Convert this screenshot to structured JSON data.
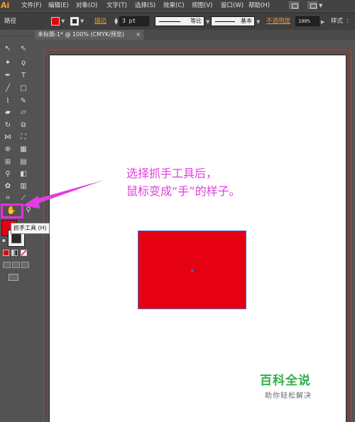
{
  "menubar": {
    "logo": "Ai",
    "items": [
      {
        "label": "文件(F)"
      },
      {
        "label": "编辑(E)"
      },
      {
        "label": "对象(O)"
      },
      {
        "label": "文字(T)"
      },
      {
        "label": "选择(S)"
      },
      {
        "label": "效果(C)"
      },
      {
        "label": "视图(V)"
      },
      {
        "label": "窗口(W)"
      },
      {
        "label": "帮助(H)"
      }
    ]
  },
  "controlbar": {
    "object_type": "路径",
    "fill_color": "#e50012",
    "stroke_label": "描边",
    "stroke_weight": "3 pt",
    "profile_label": "等比",
    "brush_label": "基本",
    "opacity_label": "不透明度",
    "opacity_value": "100%",
    "style_label": "样式"
  },
  "document": {
    "tab_title": "未标题-1* @ 100% (CMYK/预览)",
    "tab_close": "×"
  },
  "tooltip": {
    "text": "抓手工具 (H)"
  },
  "annotation": {
    "line1": "选择抓手工具后，",
    "line2": "鼠标变成“手”的样子。"
  },
  "shape": {
    "fill": "#e50012",
    "stroke": "#4a6ed0"
  },
  "watermark": {
    "title": "百科全说",
    "subtitle": "助你轻松解决"
  },
  "icons": {
    "selection": "selection-arrow-icon",
    "direct_selection": "direct-selection-arrow-icon",
    "magic_wand": "magic-wand-icon",
    "lasso": "lasso-icon",
    "pen": "pen-icon",
    "type": "type-icon",
    "line": "line-segment-icon",
    "rectangle": "rectangle-icon",
    "paintbrush": "paintbrush-icon",
    "pencil": "pencil-icon",
    "blob_brush": "blob-brush-icon",
    "eraser": "eraser-icon",
    "rotate": "rotate-icon",
    "scale": "scale-icon",
    "width": "width-icon",
    "free_transform": "free-transform-icon",
    "shape_builder": "shape-builder-icon",
    "perspective_grid": "perspective-grid-icon",
    "mesh": "mesh-icon",
    "gradient": "gradient-icon",
    "eyedropper": "eyedropper-icon",
    "blend": "blend-icon",
    "symbol_sprayer": "symbol-sprayer-icon",
    "column_graph": "column-graph-icon",
    "artboard": "artboard-icon",
    "slice": "slice-icon",
    "hand": "hand-icon",
    "zoom": "zoom-icon"
  }
}
